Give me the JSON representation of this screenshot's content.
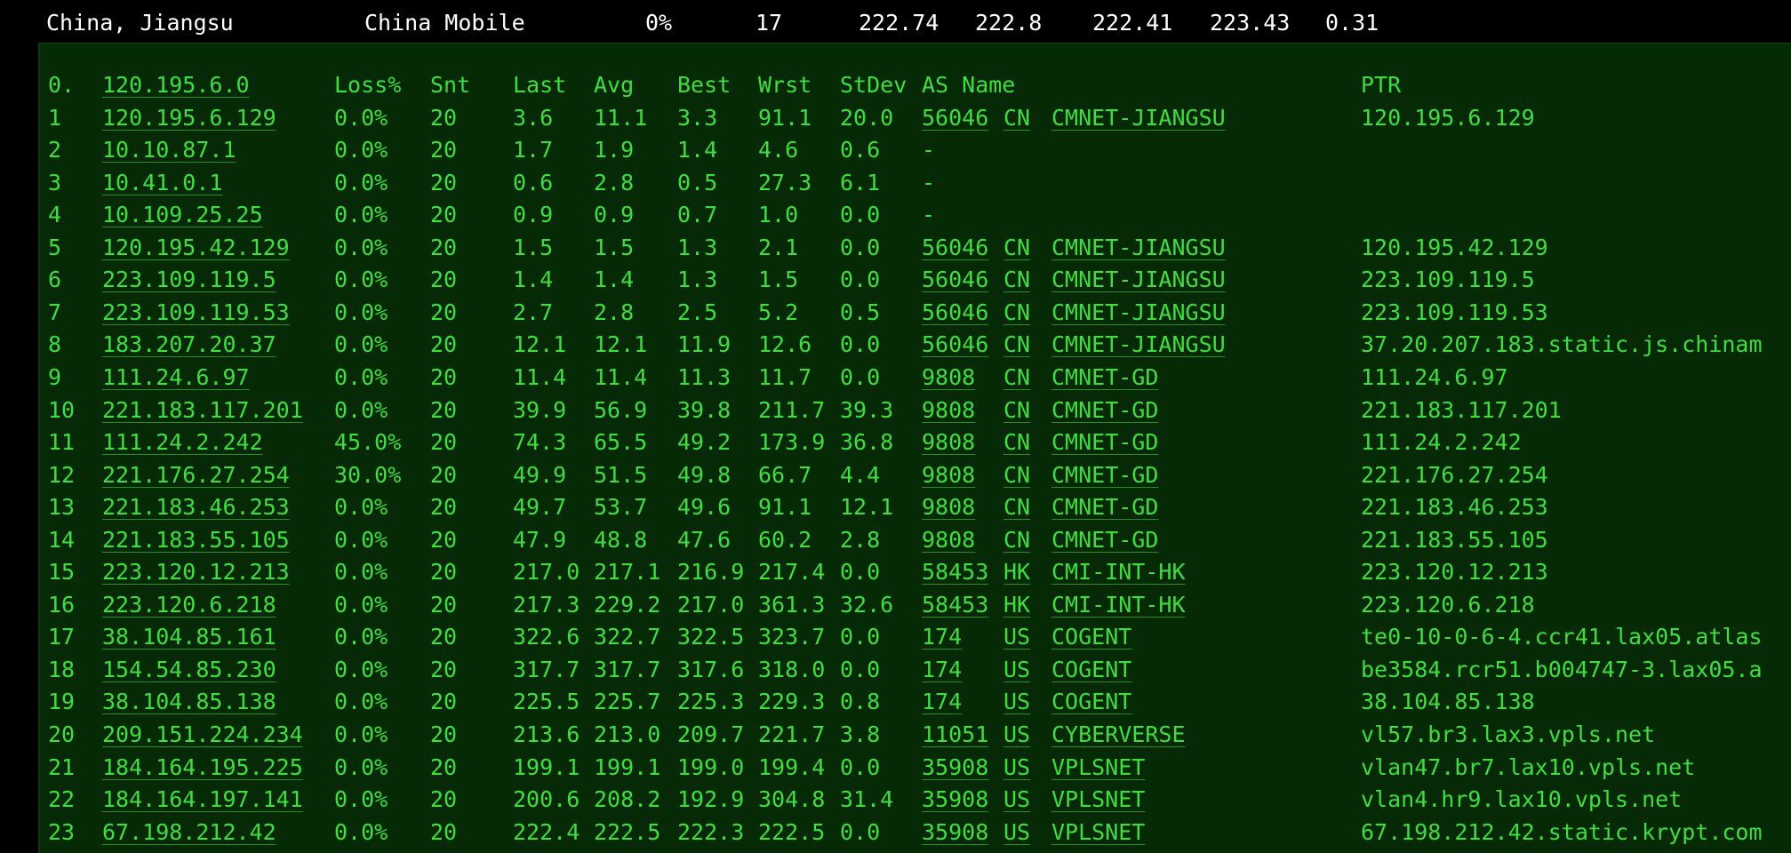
{
  "summary": {
    "location": "China, Jiangsu",
    "isp": "China Mobile",
    "loss": "0%",
    "hops": "17",
    "last": "222.74",
    "avg": "222.8",
    "best": "222.41",
    "worst": "223.43",
    "stdev": "0.31"
  },
  "table": {
    "headers": {
      "hop": "0.",
      "host": "120.195.6.0",
      "loss": "Loss%",
      "snt": "Snt",
      "last": "Last",
      "avg": "Avg",
      "best": "Best",
      "wrst": "Wrst",
      "stdev": "StDev",
      "asname": "AS Name",
      "ptr": "PTR"
    },
    "rows": [
      {
        "hop": "1",
        "host": "120.195.6.129",
        "loss": "0.0%",
        "snt": "20",
        "last": "3.6",
        "avg": "11.1",
        "best": "3.3",
        "wrst": "91.1",
        "stdev": "20.0",
        "asn": "56046",
        "cc": "CN",
        "asname": "CMNET-JIANGSU",
        "ptr": "120.195.6.129"
      },
      {
        "hop": "2",
        "host": "10.10.87.1",
        "loss": "0.0%",
        "snt": "20",
        "last": "1.7",
        "avg": "1.9",
        "best": "1.4",
        "wrst": "4.6",
        "stdev": "0.6",
        "asn": "-",
        "cc": "",
        "asname": "",
        "ptr": ""
      },
      {
        "hop": "3",
        "host": "10.41.0.1",
        "loss": "0.0%",
        "snt": "20",
        "last": "0.6",
        "avg": "2.8",
        "best": "0.5",
        "wrst": "27.3",
        "stdev": "6.1",
        "asn": "-",
        "cc": "",
        "asname": "",
        "ptr": ""
      },
      {
        "hop": "4",
        "host": "10.109.25.25",
        "loss": "0.0%",
        "snt": "20",
        "last": "0.9",
        "avg": "0.9",
        "best": "0.7",
        "wrst": "1.0",
        "stdev": "0.0",
        "asn": "-",
        "cc": "",
        "asname": "",
        "ptr": ""
      },
      {
        "hop": "5",
        "host": "120.195.42.129",
        "loss": "0.0%",
        "snt": "20",
        "last": "1.5",
        "avg": "1.5",
        "best": "1.3",
        "wrst": "2.1",
        "stdev": "0.0",
        "asn": "56046",
        "cc": "CN",
        "asname": "CMNET-JIANGSU",
        "ptr": "120.195.42.129"
      },
      {
        "hop": "6",
        "host": "223.109.119.5",
        "loss": "0.0%",
        "snt": "20",
        "last": "1.4",
        "avg": "1.4",
        "best": "1.3",
        "wrst": "1.5",
        "stdev": "0.0",
        "asn": "56046",
        "cc": "CN",
        "asname": "CMNET-JIANGSU",
        "ptr": "223.109.119.5"
      },
      {
        "hop": "7",
        "host": "223.109.119.53",
        "loss": "0.0%",
        "snt": "20",
        "last": "2.7",
        "avg": "2.8",
        "best": "2.5",
        "wrst": "5.2",
        "stdev": "0.5",
        "asn": "56046",
        "cc": "CN",
        "asname": "CMNET-JIANGSU",
        "ptr": "223.109.119.53"
      },
      {
        "hop": "8",
        "host": "183.207.20.37",
        "loss": "0.0%",
        "snt": "20",
        "last": "12.1",
        "avg": "12.1",
        "best": "11.9",
        "wrst": "12.6",
        "stdev": "0.0",
        "asn": "56046",
        "cc": "CN",
        "asname": "CMNET-JIANGSU",
        "ptr": "37.20.207.183.static.js.chinam"
      },
      {
        "hop": "9",
        "host": "111.24.6.97",
        "loss": "0.0%",
        "snt": "20",
        "last": "11.4",
        "avg": "11.4",
        "best": "11.3",
        "wrst": "11.7",
        "stdev": "0.0",
        "asn": "9808",
        "cc": "CN",
        "asname": "CMNET-GD",
        "ptr": "111.24.6.97"
      },
      {
        "hop": "10",
        "host": "221.183.117.201",
        "loss": "0.0%",
        "snt": "20",
        "last": "39.9",
        "avg": "56.9",
        "best": "39.8",
        "wrst": "211.7",
        "stdev": "39.3",
        "asn": "9808",
        "cc": "CN",
        "asname": "CMNET-GD",
        "ptr": "221.183.117.201"
      },
      {
        "hop": "11",
        "host": "111.24.2.242",
        "loss": "45.0%",
        "snt": "20",
        "last": "74.3",
        "avg": "65.5",
        "best": "49.2",
        "wrst": "173.9",
        "stdev": "36.8",
        "asn": "9808",
        "cc": "CN",
        "asname": "CMNET-GD",
        "ptr": "111.24.2.242"
      },
      {
        "hop": "12",
        "host": "221.176.27.254",
        "loss": "30.0%",
        "snt": "20",
        "last": "49.9",
        "avg": "51.5",
        "best": "49.8",
        "wrst": "66.7",
        "stdev": "4.4",
        "asn": "9808",
        "cc": "CN",
        "asname": "CMNET-GD",
        "ptr": "221.176.27.254"
      },
      {
        "hop": "13",
        "host": "221.183.46.253",
        "loss": "0.0%",
        "snt": "20",
        "last": "49.7",
        "avg": "53.7",
        "best": "49.6",
        "wrst": "91.1",
        "stdev": "12.1",
        "asn": "9808",
        "cc": "CN",
        "asname": "CMNET-GD",
        "ptr": "221.183.46.253"
      },
      {
        "hop": "14",
        "host": "221.183.55.105",
        "loss": "0.0%",
        "snt": "20",
        "last": "47.9",
        "avg": "48.8",
        "best": "47.6",
        "wrst": "60.2",
        "stdev": "2.8",
        "asn": "9808",
        "cc": "CN",
        "asname": "CMNET-GD",
        "ptr": "221.183.55.105"
      },
      {
        "hop": "15",
        "host": "223.120.12.213",
        "loss": "0.0%",
        "snt": "20",
        "last": "217.0",
        "avg": "217.1",
        "best": "216.9",
        "wrst": "217.4",
        "stdev": "0.0",
        "asn": "58453",
        "cc": "HK",
        "asname": "CMI-INT-HK",
        "ptr": "223.120.12.213"
      },
      {
        "hop": "16",
        "host": "223.120.6.218",
        "loss": "0.0%",
        "snt": "20",
        "last": "217.3",
        "avg": "229.2",
        "best": "217.0",
        "wrst": "361.3",
        "stdev": "32.6",
        "asn": "58453",
        "cc": "HK",
        "asname": "CMI-INT-HK",
        "ptr": "223.120.6.218"
      },
      {
        "hop": "17",
        "host": "38.104.85.161",
        "loss": "0.0%",
        "snt": "20",
        "last": "322.6",
        "avg": "322.7",
        "best": "322.5",
        "wrst": "323.7",
        "stdev": "0.0",
        "asn": "174",
        "cc": "US",
        "asname": "COGENT",
        "ptr": "te0-10-0-6-4.ccr41.lax05.atlas"
      },
      {
        "hop": "18",
        "host": "154.54.85.230",
        "loss": "0.0%",
        "snt": "20",
        "last": "317.7",
        "avg": "317.7",
        "best": "317.6",
        "wrst": "318.0",
        "stdev": "0.0",
        "asn": "174",
        "cc": "US",
        "asname": "COGENT",
        "ptr": "be3584.rcr51.b004747-3.lax05.a"
      },
      {
        "hop": "19",
        "host": "38.104.85.138",
        "loss": "0.0%",
        "snt": "20",
        "last": "225.5",
        "avg": "225.7",
        "best": "225.3",
        "wrst": "229.3",
        "stdev": "0.8",
        "asn": "174",
        "cc": "US",
        "asname": "COGENT",
        "ptr": "38.104.85.138"
      },
      {
        "hop": "20",
        "host": "209.151.224.234",
        "loss": "0.0%",
        "snt": "20",
        "last": "213.6",
        "avg": "213.0",
        "best": "209.7",
        "wrst": "221.7",
        "stdev": "3.8",
        "asn": "11051",
        "cc": "US",
        "asname": "CYBERVERSE",
        "ptr": "vl57.br3.lax3.vpls.net"
      },
      {
        "hop": "21",
        "host": "184.164.195.225",
        "loss": "0.0%",
        "snt": "20",
        "last": "199.1",
        "avg": "199.1",
        "best": "199.0",
        "wrst": "199.4",
        "stdev": "0.0",
        "asn": "35908",
        "cc": "US",
        "asname": "VPLSNET",
        "ptr": "vlan47.br7.lax10.vpls.net"
      },
      {
        "hop": "22",
        "host": "184.164.197.141",
        "loss": "0.0%",
        "snt": "20",
        "last": "200.6",
        "avg": "208.2",
        "best": "192.9",
        "wrst": "304.8",
        "stdev": "31.4",
        "asn": "35908",
        "cc": "US",
        "asname": "VPLSNET",
        "ptr": "vlan4.hr9.lax10.vpls.net"
      },
      {
        "hop": "23",
        "host": "67.198.212.42",
        "loss": "0.0%",
        "snt": "20",
        "last": "222.4",
        "avg": "222.5",
        "best": "222.3",
        "wrst": "222.5",
        "stdev": "0.0",
        "asn": "35908",
        "cc": "US",
        "asname": "VPLSNET",
        "ptr": "67.198.212.42.static.krypt.com"
      }
    ]
  }
}
